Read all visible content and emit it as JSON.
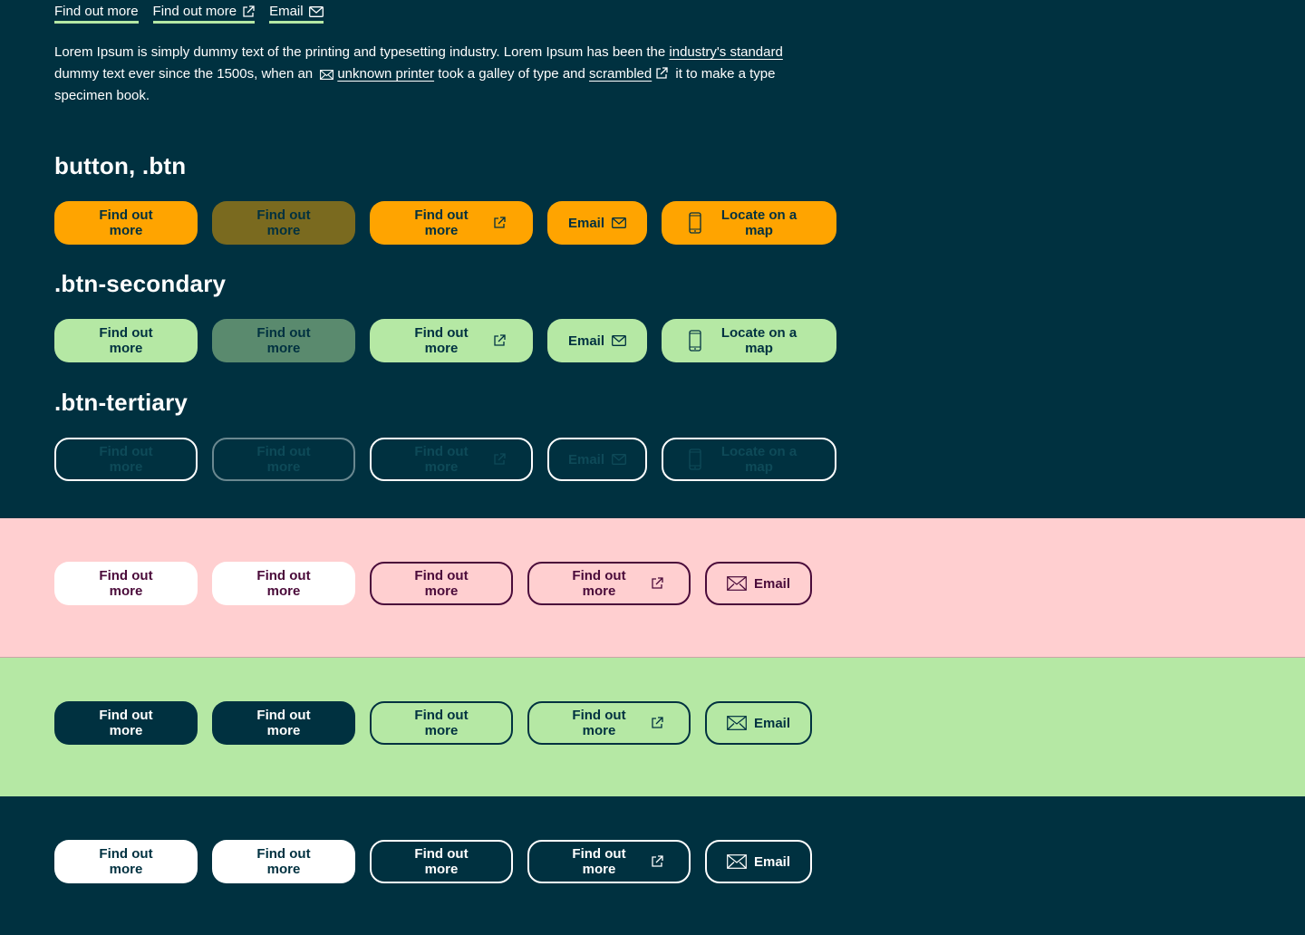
{
  "top_links": {
    "link1": "Find out more",
    "link2": "Find out more",
    "link3": "Email"
  },
  "paragraph": {
    "t1": "Lorem Ipsum is simply dummy text of the printing and typesetting industry. Lorem Ipsum has been the ",
    "link_standard": "industry's standard",
    "t2": " dummy text ever since the 1500s, when an ",
    "link_printer": "unknown printer",
    "t3": " took a galley of type and ",
    "link_scrambled": "scrambled",
    "t4": " it to make a type specimen book."
  },
  "sections": {
    "primary_heading": "button, .btn",
    "secondary_heading": ".btn-secondary",
    "tertiary_heading": ".btn-tertiary"
  },
  "buttons": {
    "find_out_more": "Find out more",
    "email": "Email",
    "locate": "Locate on a map"
  },
  "colors": {
    "navy": "#003140",
    "orange": "#ffa400",
    "green": "#b5e8a4",
    "pink": "#ffcfd0",
    "plum": "#4a0b3a",
    "white": "#ffffff"
  },
  "icons": [
    "external-link-icon",
    "mail-icon",
    "mobile-phone-icon"
  ]
}
